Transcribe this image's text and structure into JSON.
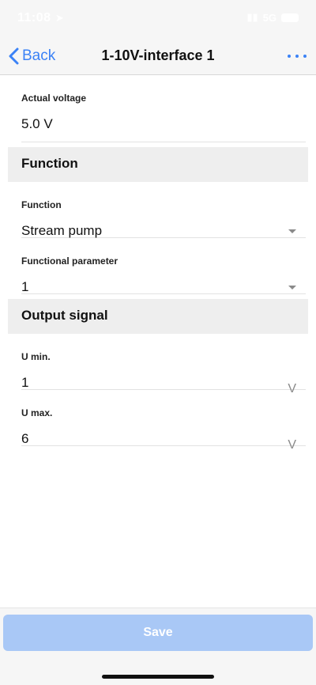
{
  "status_bar": {
    "time": "11:08",
    "network": "5G"
  },
  "nav": {
    "back_label": "Back",
    "title": "1-10V-interface 1"
  },
  "fields": {
    "actual_voltage": {
      "label": "Actual voltage",
      "value": "5.0 V"
    },
    "function": {
      "label": "Function",
      "value": "Stream pump"
    },
    "functional_parameter": {
      "label": "Functional parameter",
      "value": "1"
    },
    "u_min": {
      "label": "U min.",
      "value": "1",
      "unit": "V"
    },
    "u_max": {
      "label": "U max.",
      "value": "6",
      "unit": "V"
    }
  },
  "sections": {
    "function": "Function",
    "output_signal": "Output signal"
  },
  "footer": {
    "save_label": "Save"
  },
  "colors": {
    "accent": "#3b82f6",
    "save_disabled": "#a9c8f6",
    "section_bg": "#eeeeee"
  }
}
